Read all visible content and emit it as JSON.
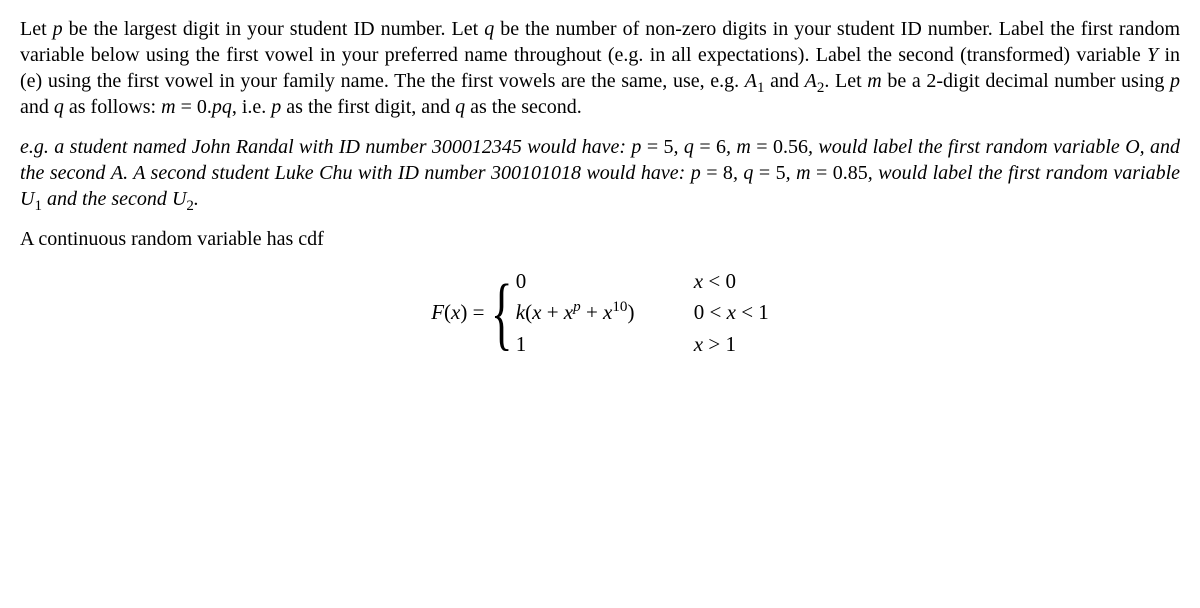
{
  "paragraphs": {
    "intro": "Let p be the largest digit in your student ID number. Let q be the number of non-zero digits in your student ID number. Label the first random variable below using the first vowel in your preferred name throughout (e.g. in all expectations). Label the second (transformed) variable Y in (e) using the first vowel in your family name. The the first vowels are the same, use, e.g. A₁ and A₂. Let m be a 2-digit decimal number using p and q as follows: m = 0.pq, i.e. p as the first digit, and q as the second.",
    "example": "e.g. a student named John Randal with ID number 300012345 would have: p = 5, q = 6, m = 0.56, would label the first random variable O, and the second A. A second student Luke Chu with ID number 300101018 would have: p = 8, q = 5, m = 0.85, would label the first random variable U₁ and the second U₂.",
    "lead": "A continuous random variable has cdf"
  },
  "equation": {
    "lhs": "F(x) = ",
    "case1_expr": "0",
    "case1_cond": "x < 0",
    "case2_expr": "k(x + xᵖ + x¹⁰)",
    "case2_cond": "0 < x < 1",
    "case3_expr": "1",
    "case3_cond": "x > 1"
  }
}
